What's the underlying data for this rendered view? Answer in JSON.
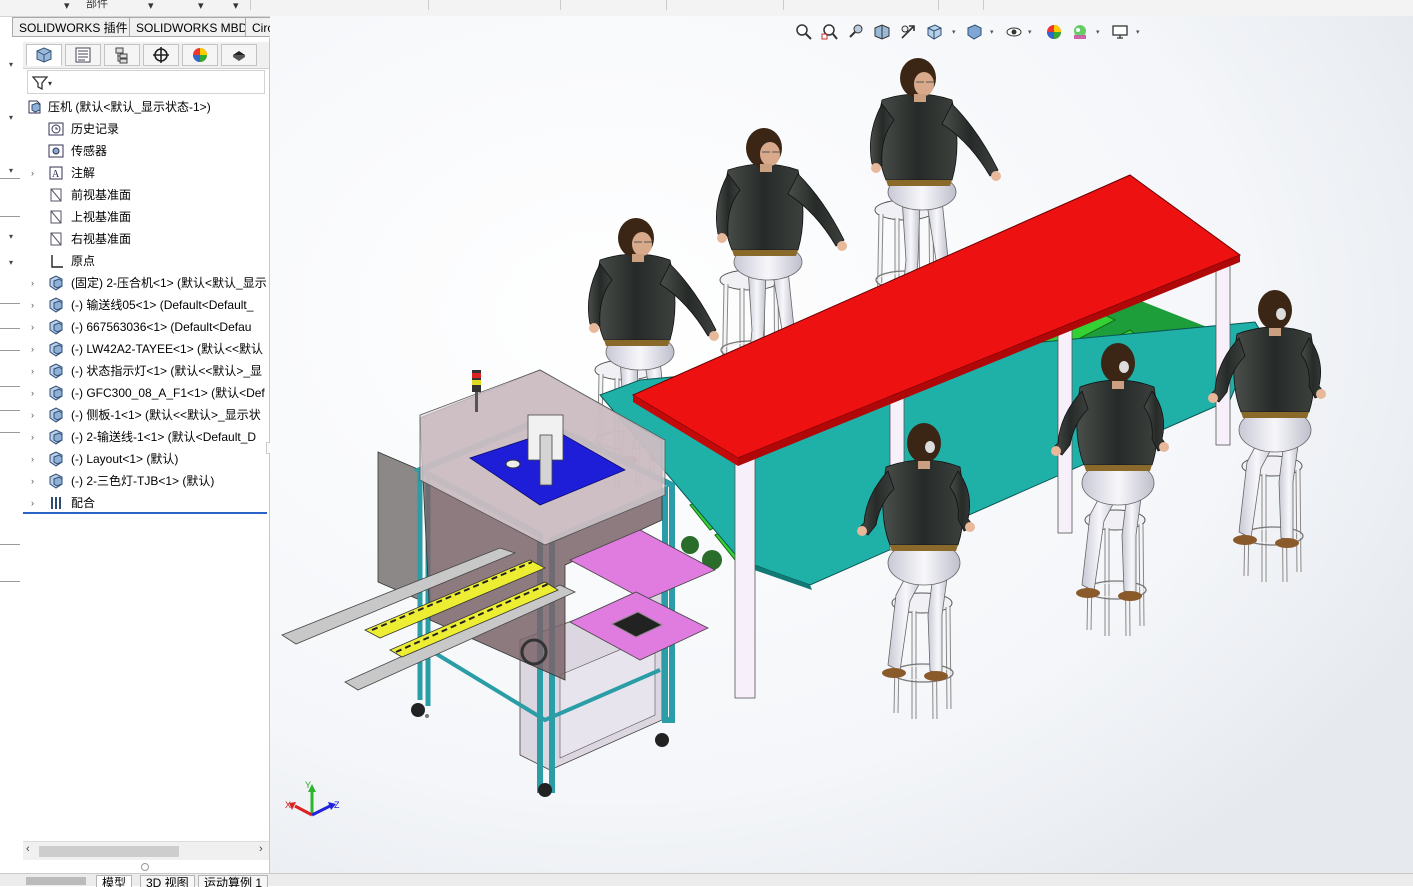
{
  "top_strip": {
    "cut_label": "部件"
  },
  "tabs": [
    "SOLIDWORKS 插件",
    "SOLIDWORKS MBD",
    "CircuitWorks"
  ],
  "panel_tabs": [
    {
      "icon": "feature-manager-icon"
    },
    {
      "icon": "property-manager-icon"
    },
    {
      "icon": "configuration-manager-icon"
    },
    {
      "icon": "dimxpert-icon"
    },
    {
      "icon": "display-manager-icon"
    },
    {
      "icon": "cam-icon"
    }
  ],
  "tree": {
    "root": "压机  (默认<默认_显示状态-1>)",
    "items": [
      {
        "label": "历史记录",
        "icon": "history-icon",
        "expand": false
      },
      {
        "label": "传感器",
        "icon": "sensor-icon",
        "expand": false
      },
      {
        "label": "注解",
        "icon": "annotation-icon",
        "expand": true
      },
      {
        "label": "前视基准面",
        "icon": "plane-icon",
        "expand": false
      },
      {
        "label": "上视基准面",
        "icon": "plane-icon",
        "expand": false
      },
      {
        "label": "右视基准面",
        "icon": "plane-icon",
        "expand": false
      },
      {
        "label": "原点",
        "icon": "origin-icon",
        "expand": false
      },
      {
        "label": "(固定) 2-压合机<1> (默认<默认_显示",
        "icon": "subassembly-icon",
        "expand": true
      },
      {
        "label": "(-) 输送线05<1> (Default<Default_",
        "icon": "subassembly-icon",
        "expand": true
      },
      {
        "label": "(-) 667563036<1> (Default<Defau",
        "icon": "subassembly-icon",
        "expand": true
      },
      {
        "label": "(-) LW42A2-TAYEE<1> (默认<<默认",
        "icon": "subassembly-icon",
        "expand": true
      },
      {
        "label": "(-) 状态指示灯<1> (默认<<默认>_显",
        "icon": "subassembly-icon",
        "expand": true
      },
      {
        "label": "(-) GFC300_08_A_F1<1> (默认<Def",
        "icon": "subassembly-icon",
        "expand": true
      },
      {
        "label": "(-) 侧板-1<1> (默认<<默认>_显示状",
        "icon": "subassembly-icon",
        "expand": true
      },
      {
        "label": "(-) 2-输送线-1<1> (默认<Default_D",
        "icon": "subassembly-icon",
        "expand": true
      },
      {
        "label": "(-) Layout<1> (默认)",
        "icon": "subassembly-icon",
        "expand": true
      },
      {
        "label": "(-) 2-三色灯-TJB<1> (默认)",
        "icon": "subassembly-icon",
        "expand": true
      },
      {
        "label": "配合",
        "icon": "mates-icon",
        "expand": true
      }
    ]
  },
  "bottom_tabs": [
    "模型",
    "3D 视图",
    "运动算例 1"
  ],
  "triad": {
    "x": "X",
    "y": "Y",
    "z": "Z"
  },
  "view_tools": [
    "zoom-to-fit-icon",
    "zoom-area-icon",
    "previous-view-icon",
    "section-view-icon",
    "dynamic-annotation-icon",
    "view-orientation-icon",
    "display-style-icon",
    "hide-show-icon",
    "edit-appearance-icon",
    "apply-scene-icon",
    "view-settings-icon"
  ],
  "colors": {
    "table_top": "#ee1111",
    "table_shelf": "#1aa7a0",
    "conveyor_belt": "#22cc22",
    "machine_frame": "#2a9da6",
    "press_plate": "#1e1ed8",
    "tray_pink": "#e07be0",
    "shirt_dark": "#2f3431",
    "pants_white": "#dedee8",
    "chair_seat": "#e8e8ee"
  }
}
